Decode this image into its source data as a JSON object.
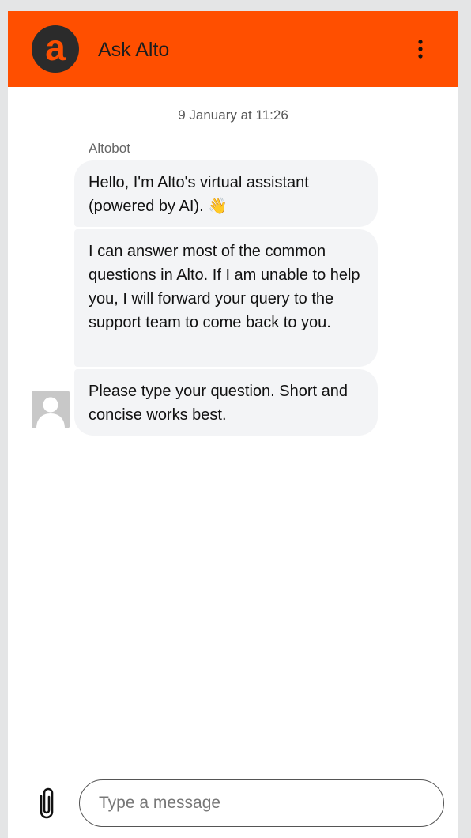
{
  "header": {
    "title": "Ask Alto",
    "logo_letter": "a",
    "menu_icon": "vertical-ellipsis-icon",
    "brand_color": "#ff4f00"
  },
  "conversation": {
    "timestamp": "9 January at 11:26",
    "sender": "Altobot",
    "messages": [
      {
        "text": "Hello, I'm Alto's virtual assistant (powered by AI). 👋"
      },
      {
        "text": "I can answer most of the common questions in Alto. If I am unable to help you, I will forward your query to the support team to come back to you."
      },
      {
        "text": "Please type your question. Short and concise works best."
      }
    ],
    "avatar_icon": "default-user-avatar-icon"
  },
  "composer": {
    "placeholder": "Type a message",
    "attach_icon": "paperclip-icon"
  }
}
